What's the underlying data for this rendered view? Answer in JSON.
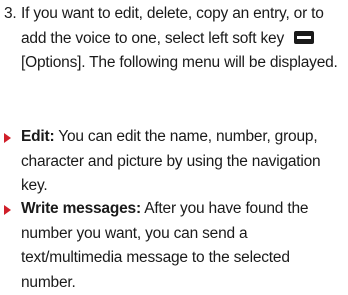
{
  "step": {
    "number": "3.",
    "text_before_icon": "If you want to edit, delete, copy an entry, or to add the voice to one, select left soft key",
    "softkey_icon": "left-soft-key-icon",
    "text_after_icon": "[Options]. The following menu will be displayed."
  },
  "bullets": [
    {
      "term": "Edit:",
      "text": "You can edit the name, number, group, character and picture by using the navigation key."
    },
    {
      "term": "Write messages:",
      "text": "After you have found the number you want, you can send a text/multimedia message to the selected number."
    }
  ],
  "colors": {
    "bullet_marker": "#d01f2a",
    "text": "#1a1a1a"
  }
}
